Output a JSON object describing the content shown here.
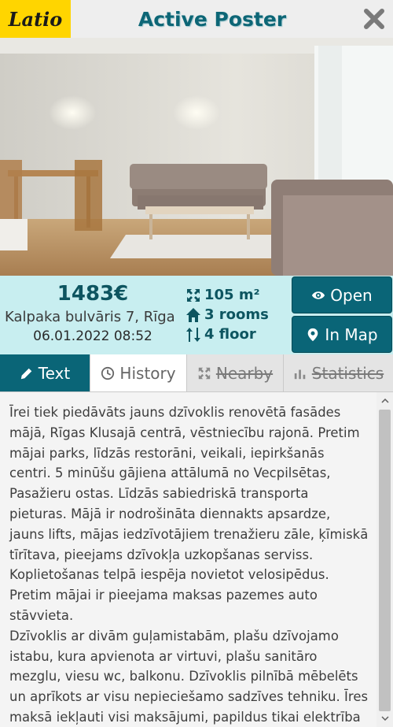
{
  "header": {
    "logo_text": "Latio",
    "title": "Active Poster",
    "close_icon": "close-icon"
  },
  "listing": {
    "price": "1483€",
    "address": "Kalpaka bulvāris 7, Rīga",
    "date": "06.01.2022 08:52",
    "area": "105 m²",
    "rooms": "3 rooms",
    "floor": "4 floor"
  },
  "actions": {
    "open_label": "Open",
    "map_label": "In Map"
  },
  "tabs": [
    {
      "label": "Text",
      "icon": "pencil-icon",
      "active": true
    },
    {
      "label": "History",
      "icon": "clock-icon",
      "active": false
    },
    {
      "label": "Nearby",
      "icon": "expand-icon",
      "disabled": true
    },
    {
      "label": "Statistics",
      "icon": "chart-icon",
      "disabled": true
    }
  ],
  "description": {
    "paragraph_1": "Īrei tiek piedāvāts jauns dzīvoklis renovētā fasādes mājā, Rīgas Klusajā centrā, vēstniecību rajonā. Pretim mājai parks, līdzās restorāni, veikali, iepirkšanās centri. 5 minūšu gājiena attālumā no Vecpilsētas, Pasažieru ostas. Līdzās sabiedriskā transporta pieturas. Mājā ir nodrošināta diennakts apsardze, jauns lifts, mājas iedzīvotājiem trenažieru zāle, ķīmiskā tīrītava, pieejams dzīvokļa uzkopšanas serviss. Koplietošanas telpā iespēja novietot velosipēdus. Pretim mājai ir pieejama maksas pazemes auto stāvvieta.",
    "paragraph_2": "Dzīvoklis ar divām guļamistabām, plašu dzīvojamo istabu, kura apvienota ar virtuvi, plašu sanitāro mezglu, viesu wc, balkonu. Dzīvoklis pilnībā mēbelēts un aprīkots ar visu nepieciešamo sadzīves tehniku. Īres maksā iekļauti visi maksājumi, papildus tikai elektrība pēc skaitītāja."
  },
  "colors": {
    "accent": "#0a6577",
    "info_bg": "#c8eef0",
    "logo_bg": "#ffd500"
  }
}
